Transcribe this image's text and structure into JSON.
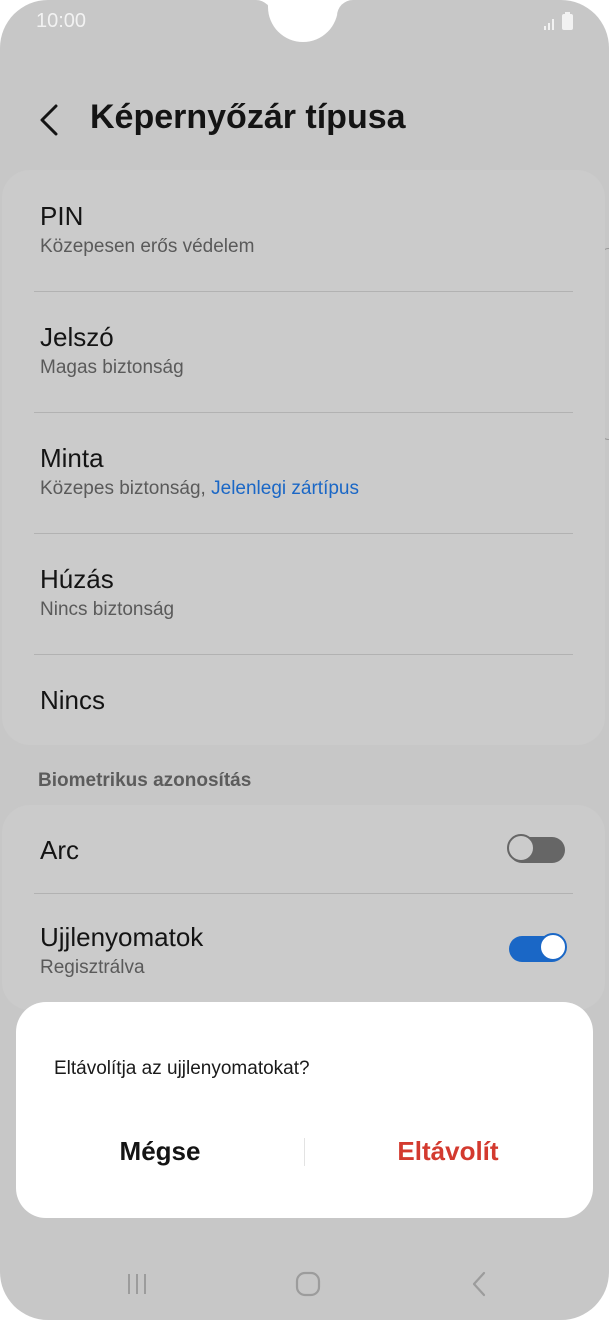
{
  "status_bar": {
    "time": "10:00"
  },
  "header": {
    "title": "Képernyőzár típusa"
  },
  "lock_types": [
    {
      "title": "PIN",
      "subtitle": "Közepesen erős védelem"
    },
    {
      "title": "Jelszó",
      "subtitle": "Magas biztonság"
    },
    {
      "title": "Minta",
      "subtitle": "Közepes biztonság, ",
      "subtitle_highlight": "Jelenlegi zártípus"
    },
    {
      "title": "Húzás",
      "subtitle": "Nincs biztonság"
    },
    {
      "title": "Nincs"
    }
  ],
  "biometrics": {
    "section_label": "Biometrikus azonosítás",
    "items": [
      {
        "title": "Arc",
        "enabled": false
      },
      {
        "title": "Ujjlenyomatok",
        "subtitle": "Regisztrálva",
        "enabled": true
      }
    ]
  },
  "dialog": {
    "message": "Eltávolítja az ujjlenyomatokat?",
    "cancel_label": "Mégse",
    "confirm_label": "Eltávolít"
  },
  "nav_bar": {
    "icons": [
      "recent-apps-icon",
      "home-icon",
      "back-icon"
    ]
  },
  "colors": {
    "accent": "#1a67c6",
    "destructive": "#d33a2f"
  }
}
